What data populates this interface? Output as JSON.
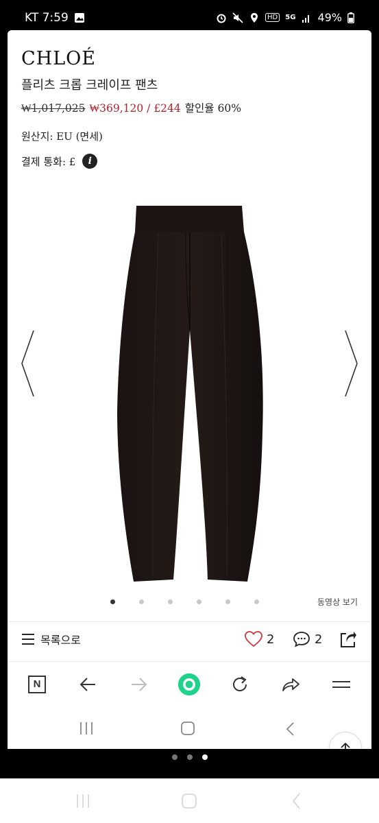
{
  "status_bar": {
    "carrier_time": "KT 7:59",
    "hd_badge": "HD",
    "network": "5G",
    "battery": "49%"
  },
  "product": {
    "brand": "CHLOÉ",
    "name": "플리츠 크롭 크레이프 팬츠",
    "original_price": "₩1,017,025",
    "sale_price": "₩369,120 / £244",
    "discount": "할인율 60%",
    "origin": "원산지: EU (면세)",
    "currency": "결제 통화: £",
    "info_icon_glyph": "i"
  },
  "gallery": {
    "page_count": 6,
    "active_index": 0,
    "video_label": "동영상 보기"
  },
  "action_bar": {
    "list_label": "목록으로",
    "like_count": "2",
    "comment_count": "2"
  },
  "browser_bar": {
    "n_button": "N"
  },
  "colors": {
    "sale_price": "#b3202a",
    "home_button": "#1fd38a",
    "like_heart": "#d0343f"
  },
  "icons": [
    "back-arrow-icon",
    "forward-arrow-icon",
    "reload-icon",
    "share-icon",
    "menu-icon",
    "heart-icon",
    "comment-icon",
    "scroll-top-arrow-icon",
    "chevron-left-icon",
    "chevron-right-icon"
  ]
}
